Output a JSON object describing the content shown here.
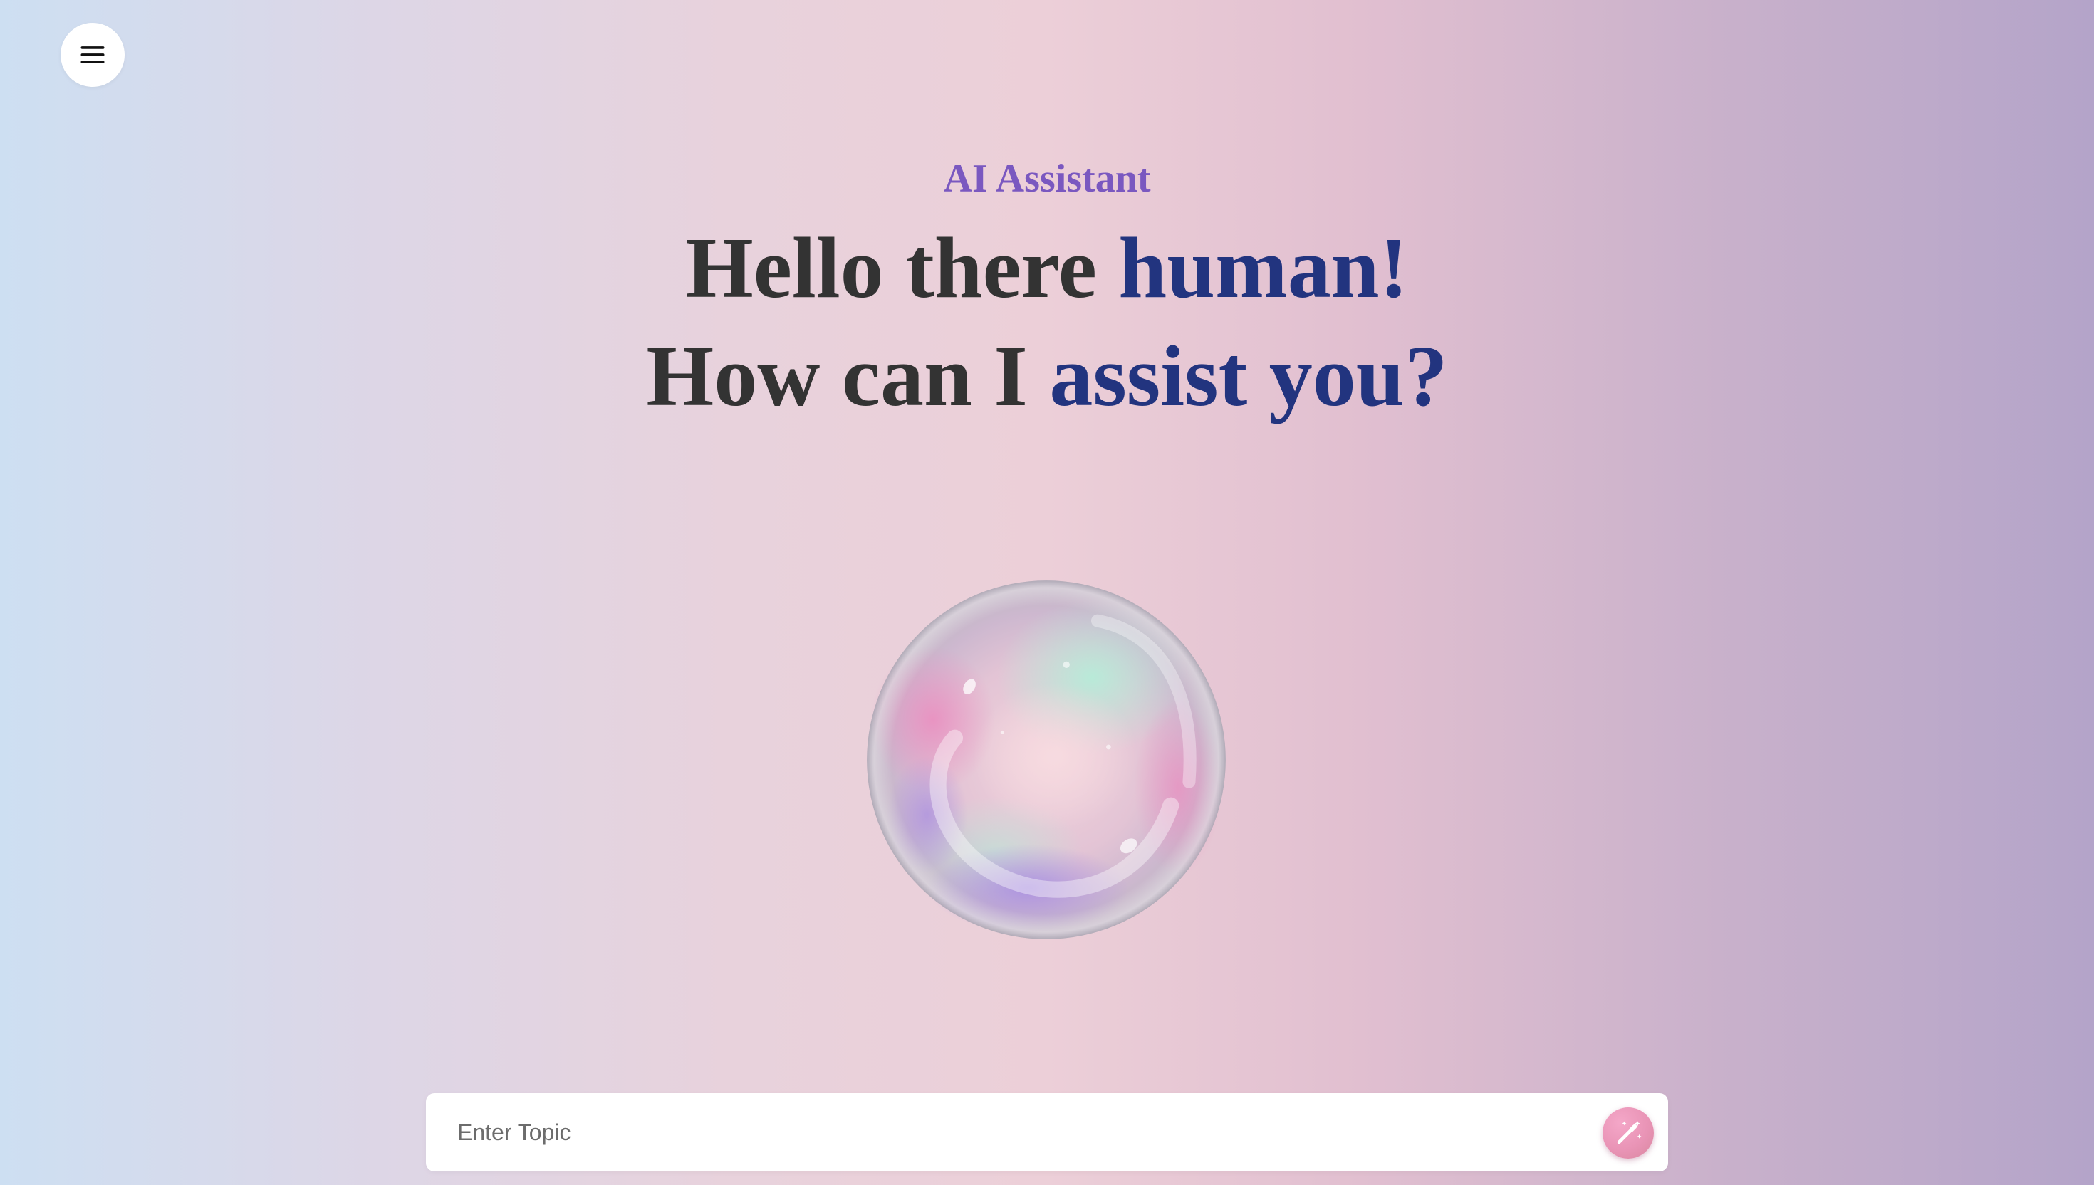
{
  "header": {
    "menu_icon": "hamburger-menu-icon",
    "subtitle": "AI Assistant"
  },
  "hero": {
    "line1_plain": "Hello there ",
    "line1_accent": "human!",
    "line2_plain": "How can I ",
    "line2_accent": "assist you?"
  },
  "orb": {
    "icon": "iridescent-bubble"
  },
  "topic": {
    "placeholder": "Enter Topic",
    "value": "",
    "submit_icon": "magic-wand-icon"
  },
  "colors": {
    "subtitle": "#7a58c0",
    "headline": "#333333",
    "accent": "#22347f",
    "submit_button": "#e994b6"
  }
}
